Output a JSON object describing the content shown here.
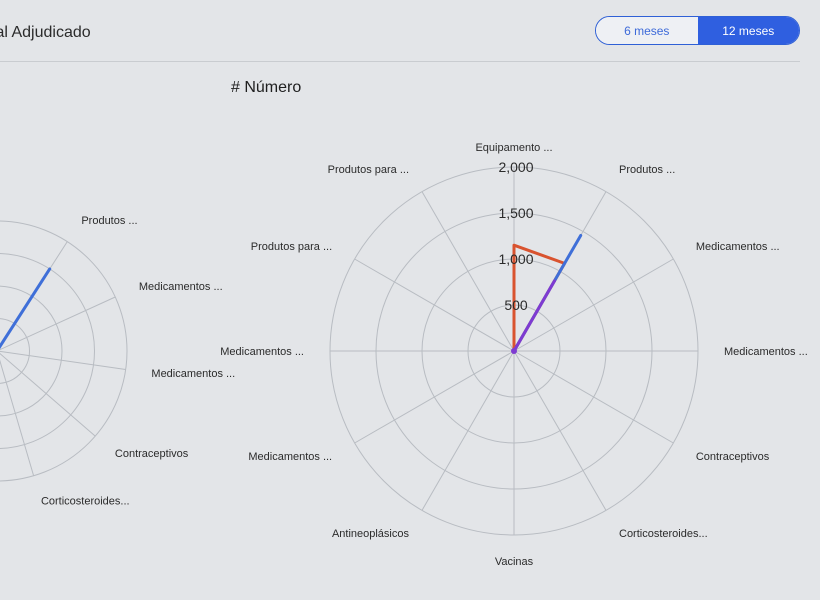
{
  "header": {
    "title": "tal Adjudicado"
  },
  "toggle": {
    "options": [
      "6 meses",
      "12 meses"
    ],
    "selected": "12 meses"
  },
  "colors": {
    "accent": "#2f5fe0",
    "grid": "#b8bcc2",
    "orange": "#d9532f",
    "blue": "#3f6fd8",
    "purple": "#7e3bd1"
  },
  "chart_data": [
    {
      "type": "radar",
      "title": "",
      "axes": [
        "",
        "Produtos ...",
        "Medicamentos ...",
        "Medicamentos ...",
        "Contraceptivos",
        "Corticosteroides...",
        "",
        "",
        "",
        "",
        ""
      ],
      "series": [
        {
          "values": [
            0,
            1500,
            0,
            0,
            0,
            0,
            0,
            0,
            0,
            0,
            0
          ]
        }
      ]
    },
    {
      "type": "radar",
      "title": "# Número",
      "axes": [
        "Equipamento ...",
        "Produtos ...",
        "Medicamentos ...",
        "Medicamentos ...",
        "Contraceptivos",
        "Corticosteroides...",
        "Vacinas",
        "Antineoplásicos",
        "Medicamentos ...",
        "Medicamentos ...",
        "Produtos para ...",
        "Produtos para ..."
      ],
      "radial_ticks": [
        "500",
        "1,000",
        "1,500",
        "2,000"
      ],
      "rmax": 2000,
      "series": [
        {
          "color": "orange",
          "values": [
            1150,
            1100,
            0,
            0,
            0,
            0,
            0,
            0,
            0,
            0,
            0,
            0
          ]
        },
        {
          "color": "blue",
          "values": [
            0,
            1450,
            0,
            0,
            0,
            0,
            0,
            0,
            0,
            0,
            0,
            0
          ]
        },
        {
          "color": "purple",
          "values": [
            0,
            880,
            0,
            0,
            0,
            0,
            0,
            0,
            0,
            0,
            0,
            0
          ]
        }
      ]
    }
  ]
}
